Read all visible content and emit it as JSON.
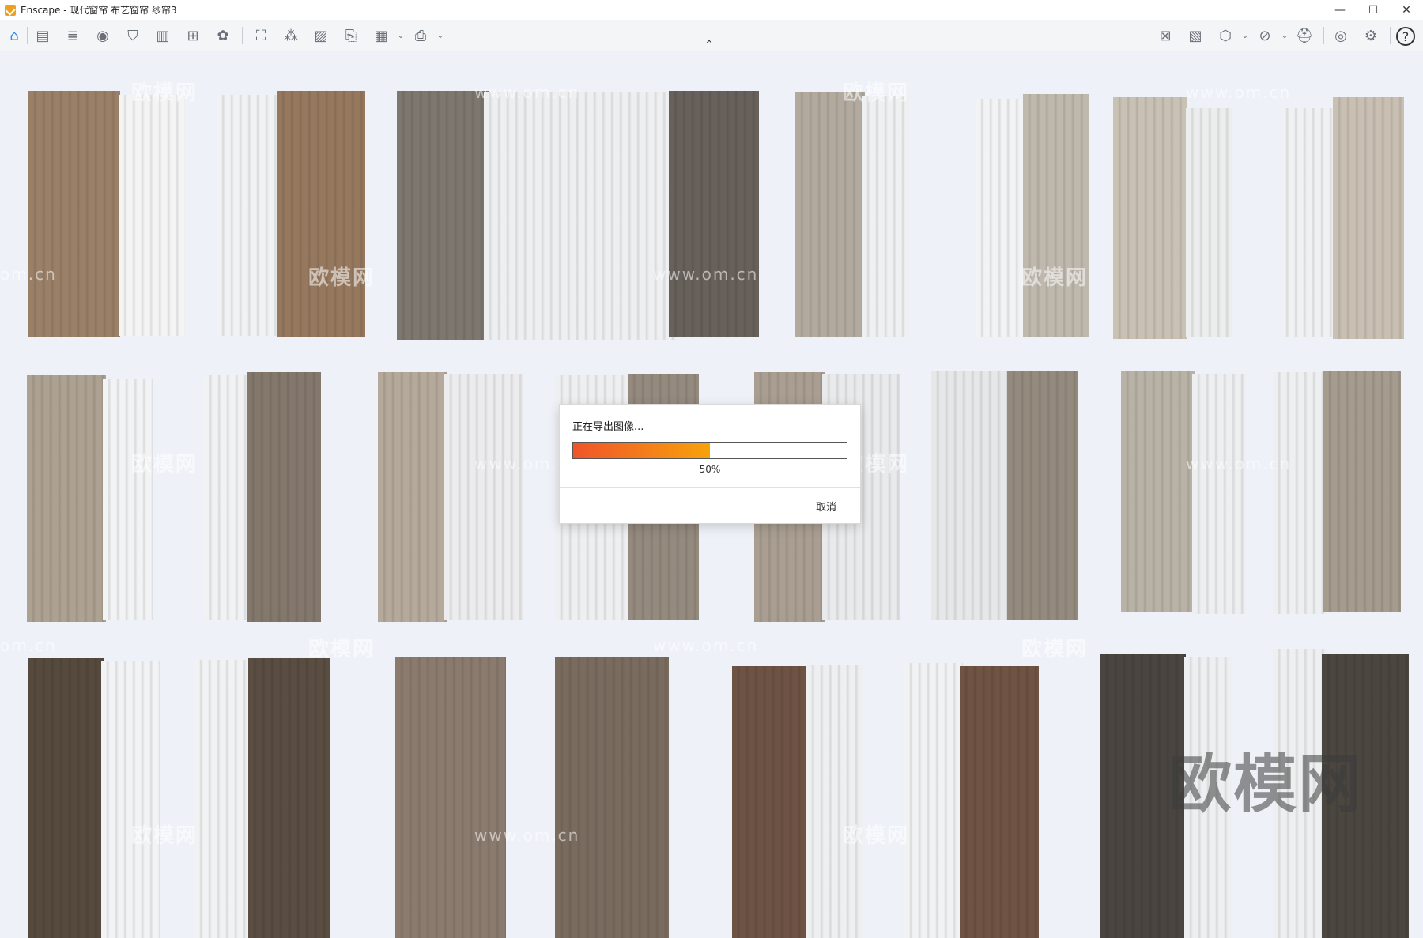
{
  "window": {
    "title": "Enscape - 现代窗帘 布艺窗帘 纱帘3",
    "minimize": "—",
    "maximize": "☐",
    "close": "✕"
  },
  "toolbar": {
    "left_icons": [
      "home-icon",
      "project-icon",
      "bim-icon",
      "view-icon",
      "shield-icon",
      "book-icon",
      "add-screenshot-icon",
      "asset-library-icon",
      "capture-icon",
      "magic-wand-icon",
      "image-icon",
      "export-file-icon",
      "video-editor-icon",
      "export-icon"
    ],
    "right_icons": [
      "map-icon",
      "image-gallery-icon",
      "cube-icon",
      "material-icon",
      "vr-headset-icon",
      "eye-icon",
      "settings-icon",
      "help-icon"
    ],
    "collapse_glyph": "^"
  },
  "dialog": {
    "title": "正在导出图像...",
    "progress": 0.5,
    "progress_label": "50%",
    "cancel_label": "取消"
  },
  "watermarks": {
    "brand": "欧模网",
    "url": "www.om.cn",
    "url_short": "om.cn",
    "big": "欧模网"
  },
  "colors": {
    "progress_start": "#f0542a",
    "progress_end": "#f7a20c",
    "home_icon": "#2f8ef0",
    "app_icon": "#f0a020"
  }
}
